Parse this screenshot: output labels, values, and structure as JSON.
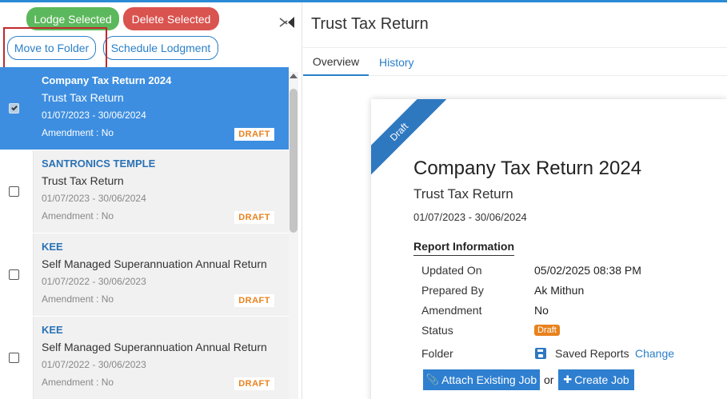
{
  "toolbar": {
    "lodge_selected": "Lodge Selected",
    "delete_selected": "Delete Selected",
    "move_to_folder": "Move to Folder",
    "schedule_lodgment": "Schedule Lodgment"
  },
  "list": {
    "items": [
      {
        "name": "Company Tax Return 2024",
        "type": "Trust Tax Return",
        "dates": "01/07/2023 - 30/06/2024",
        "amendment": "Amendment : No",
        "status": "DRAFT",
        "selected": true
      },
      {
        "name": "SANTRONICS TEMPLE",
        "type": "Trust Tax Return",
        "dates": "01/07/2023 - 30/06/2024",
        "amendment": "Amendment : No",
        "status": "DRAFT",
        "selected": false
      },
      {
        "name": "KEE",
        "type": "Self Managed Superannuation Annual Return",
        "dates": "01/07/2022 - 30/06/2023",
        "amendment": "Amendment : No",
        "status": "DRAFT",
        "selected": false
      },
      {
        "name": "KEE",
        "type": "Self Managed Superannuation Annual Return",
        "dates": "01/07/2022 - 30/06/2023",
        "amendment": "Amendment : No",
        "status": "DRAFT",
        "selected": false
      }
    ]
  },
  "detail": {
    "panel_title": "Trust Tax Return",
    "tabs": {
      "overview": "Overview",
      "history": "History"
    },
    "ribbon": "Draft",
    "title": "Company Tax Return 2024",
    "subtitle": "Trust Tax Return",
    "dates": "01/07/2023 - 30/06/2024",
    "section_heading": "Report Information",
    "labels": {
      "updated_on": "Updated On",
      "prepared_by": "Prepared By",
      "amendment": "Amendment",
      "status": "Status",
      "folder": "Folder"
    },
    "values": {
      "updated_on": "05/02/2025 08:38 PM",
      "prepared_by": "Ak Mithun",
      "amendment": "No",
      "status": "Draft",
      "folder": "Saved Reports",
      "change": "Change"
    },
    "actions": {
      "attach_existing_job": "Attach Existing Job",
      "or": "or",
      "create_job": "Create Job"
    }
  },
  "colors": {
    "accent": "#2b8ad6",
    "selected_row": "#3d8ee0",
    "lodge_green": "#5cb85c",
    "delete_red": "#d9534f",
    "draft_orange": "#e8821e",
    "highlight_red": "#c0292b"
  },
  "icons": {
    "collapse": "collapse-left-icon",
    "attach": "paperclip-icon",
    "create": "plus-icon",
    "folder": "save-icon"
  }
}
